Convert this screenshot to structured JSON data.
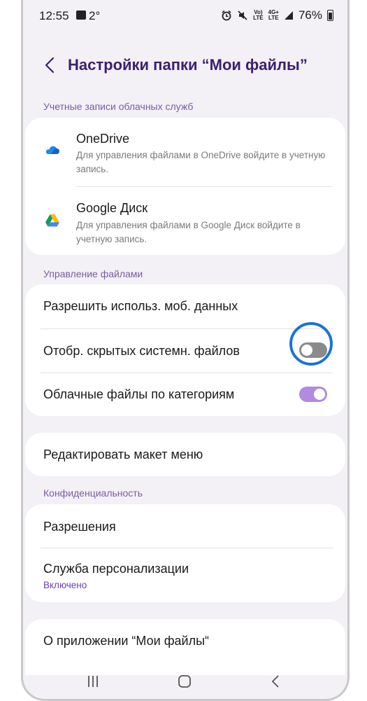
{
  "status_bar": {
    "time": "12:55",
    "temperature": "2°",
    "battery": "76%",
    "lte_top": "Vo)",
    "lte_bottom": "LTE",
    "net_top": "4G+",
    "net_bottom": "LTE"
  },
  "header": {
    "title": "Настройки папки “Мои файлы”"
  },
  "cloud": {
    "section_label": "Учетные записи облачных служб",
    "accounts": [
      {
        "name": "OneDrive",
        "description": "Для управления файлами в OneDrive войдите в учетную запись."
      },
      {
        "name": "Google Диск",
        "description": "Для управления файлами в Google Диск войдите в учетную запись."
      }
    ]
  },
  "file_management": {
    "section_label": "Управление файлами",
    "mobile_data_label": "Разрешить использ. моб. данных",
    "hidden_files_label": "Отобр. скрытых системн. файлов",
    "hidden_files_enabled": false,
    "cloud_by_category_label": "Облачные файлы по категориям",
    "cloud_by_category_enabled": true
  },
  "menu": {
    "edit_layout_label": "Редактировать макет меню"
  },
  "privacy": {
    "section_label": "Конфиденциальность",
    "permissions_label": "Разрешения",
    "personalization_label": "Служба персонализации",
    "personalization_status": "Включено"
  },
  "about": {
    "label": "О приложении “Мои файлы“"
  },
  "colors": {
    "accent": "#3c1f6e",
    "section": "#7a5da0",
    "toggle_on": "#b08be0",
    "toggle_off": "#8a8a8a",
    "highlight": "#1a73d6"
  }
}
